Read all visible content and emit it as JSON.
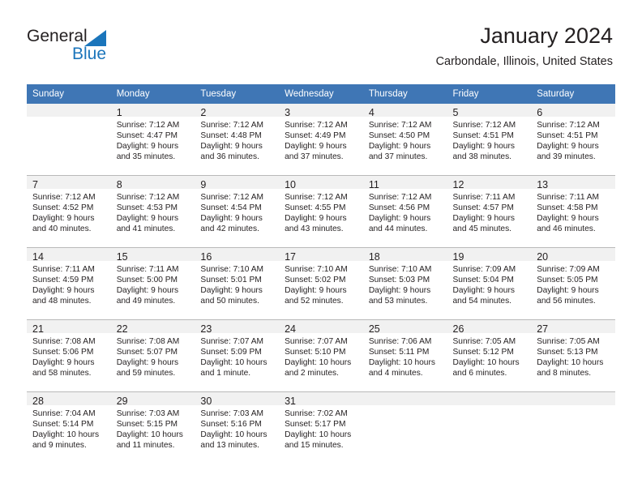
{
  "brand": {
    "name_part1": "General",
    "name_part2": "Blue",
    "logo_icon": "triangle-icon",
    "accent_color": "#1b75bb"
  },
  "header": {
    "title": "January 2024",
    "location": "Carbondale, Illinois, United States",
    "header_bg_color": "#3f76b5"
  },
  "weekdays": [
    "Sunday",
    "Monday",
    "Tuesday",
    "Wednesday",
    "Thursday",
    "Friday",
    "Saturday"
  ],
  "weeks": [
    [
      {
        "day": "",
        "sunrise": "",
        "sunset": "",
        "daylight1": "",
        "daylight2": ""
      },
      {
        "day": "1",
        "sunrise": "Sunrise: 7:12 AM",
        "sunset": "Sunset: 4:47 PM",
        "daylight1": "Daylight: 9 hours",
        "daylight2": "and 35 minutes."
      },
      {
        "day": "2",
        "sunrise": "Sunrise: 7:12 AM",
        "sunset": "Sunset: 4:48 PM",
        "daylight1": "Daylight: 9 hours",
        "daylight2": "and 36 minutes."
      },
      {
        "day": "3",
        "sunrise": "Sunrise: 7:12 AM",
        "sunset": "Sunset: 4:49 PM",
        "daylight1": "Daylight: 9 hours",
        "daylight2": "and 37 minutes."
      },
      {
        "day": "4",
        "sunrise": "Sunrise: 7:12 AM",
        "sunset": "Sunset: 4:50 PM",
        "daylight1": "Daylight: 9 hours",
        "daylight2": "and 37 minutes."
      },
      {
        "day": "5",
        "sunrise": "Sunrise: 7:12 AM",
        "sunset": "Sunset: 4:51 PM",
        "daylight1": "Daylight: 9 hours",
        "daylight2": "and 38 minutes."
      },
      {
        "day": "6",
        "sunrise": "Sunrise: 7:12 AM",
        "sunset": "Sunset: 4:51 PM",
        "daylight1": "Daylight: 9 hours",
        "daylight2": "and 39 minutes."
      }
    ],
    [
      {
        "day": "7",
        "sunrise": "Sunrise: 7:12 AM",
        "sunset": "Sunset: 4:52 PM",
        "daylight1": "Daylight: 9 hours",
        "daylight2": "and 40 minutes."
      },
      {
        "day": "8",
        "sunrise": "Sunrise: 7:12 AM",
        "sunset": "Sunset: 4:53 PM",
        "daylight1": "Daylight: 9 hours",
        "daylight2": "and 41 minutes."
      },
      {
        "day": "9",
        "sunrise": "Sunrise: 7:12 AM",
        "sunset": "Sunset: 4:54 PM",
        "daylight1": "Daylight: 9 hours",
        "daylight2": "and 42 minutes."
      },
      {
        "day": "10",
        "sunrise": "Sunrise: 7:12 AM",
        "sunset": "Sunset: 4:55 PM",
        "daylight1": "Daylight: 9 hours",
        "daylight2": "and 43 minutes."
      },
      {
        "day": "11",
        "sunrise": "Sunrise: 7:12 AM",
        "sunset": "Sunset: 4:56 PM",
        "daylight1": "Daylight: 9 hours",
        "daylight2": "and 44 minutes."
      },
      {
        "day": "12",
        "sunrise": "Sunrise: 7:11 AM",
        "sunset": "Sunset: 4:57 PM",
        "daylight1": "Daylight: 9 hours",
        "daylight2": "and 45 minutes."
      },
      {
        "day": "13",
        "sunrise": "Sunrise: 7:11 AM",
        "sunset": "Sunset: 4:58 PM",
        "daylight1": "Daylight: 9 hours",
        "daylight2": "and 46 minutes."
      }
    ],
    [
      {
        "day": "14",
        "sunrise": "Sunrise: 7:11 AM",
        "sunset": "Sunset: 4:59 PM",
        "daylight1": "Daylight: 9 hours",
        "daylight2": "and 48 minutes."
      },
      {
        "day": "15",
        "sunrise": "Sunrise: 7:11 AM",
        "sunset": "Sunset: 5:00 PM",
        "daylight1": "Daylight: 9 hours",
        "daylight2": "and 49 minutes."
      },
      {
        "day": "16",
        "sunrise": "Sunrise: 7:10 AM",
        "sunset": "Sunset: 5:01 PM",
        "daylight1": "Daylight: 9 hours",
        "daylight2": "and 50 minutes."
      },
      {
        "day": "17",
        "sunrise": "Sunrise: 7:10 AM",
        "sunset": "Sunset: 5:02 PM",
        "daylight1": "Daylight: 9 hours",
        "daylight2": "and 52 minutes."
      },
      {
        "day": "18",
        "sunrise": "Sunrise: 7:10 AM",
        "sunset": "Sunset: 5:03 PM",
        "daylight1": "Daylight: 9 hours",
        "daylight2": "and 53 minutes."
      },
      {
        "day": "19",
        "sunrise": "Sunrise: 7:09 AM",
        "sunset": "Sunset: 5:04 PM",
        "daylight1": "Daylight: 9 hours",
        "daylight2": "and 54 minutes."
      },
      {
        "day": "20",
        "sunrise": "Sunrise: 7:09 AM",
        "sunset": "Sunset: 5:05 PM",
        "daylight1": "Daylight: 9 hours",
        "daylight2": "and 56 minutes."
      }
    ],
    [
      {
        "day": "21",
        "sunrise": "Sunrise: 7:08 AM",
        "sunset": "Sunset: 5:06 PM",
        "daylight1": "Daylight: 9 hours",
        "daylight2": "and 58 minutes."
      },
      {
        "day": "22",
        "sunrise": "Sunrise: 7:08 AM",
        "sunset": "Sunset: 5:07 PM",
        "daylight1": "Daylight: 9 hours",
        "daylight2": "and 59 minutes."
      },
      {
        "day": "23",
        "sunrise": "Sunrise: 7:07 AM",
        "sunset": "Sunset: 5:09 PM",
        "daylight1": "Daylight: 10 hours",
        "daylight2": "and 1 minute."
      },
      {
        "day": "24",
        "sunrise": "Sunrise: 7:07 AM",
        "sunset": "Sunset: 5:10 PM",
        "daylight1": "Daylight: 10 hours",
        "daylight2": "and 2 minutes."
      },
      {
        "day": "25",
        "sunrise": "Sunrise: 7:06 AM",
        "sunset": "Sunset: 5:11 PM",
        "daylight1": "Daylight: 10 hours",
        "daylight2": "and 4 minutes."
      },
      {
        "day": "26",
        "sunrise": "Sunrise: 7:05 AM",
        "sunset": "Sunset: 5:12 PM",
        "daylight1": "Daylight: 10 hours",
        "daylight2": "and 6 minutes."
      },
      {
        "day": "27",
        "sunrise": "Sunrise: 7:05 AM",
        "sunset": "Sunset: 5:13 PM",
        "daylight1": "Daylight: 10 hours",
        "daylight2": "and 8 minutes."
      }
    ],
    [
      {
        "day": "28",
        "sunrise": "Sunrise: 7:04 AM",
        "sunset": "Sunset: 5:14 PM",
        "daylight1": "Daylight: 10 hours",
        "daylight2": "and 9 minutes."
      },
      {
        "day": "29",
        "sunrise": "Sunrise: 7:03 AM",
        "sunset": "Sunset: 5:15 PM",
        "daylight1": "Daylight: 10 hours",
        "daylight2": "and 11 minutes."
      },
      {
        "day": "30",
        "sunrise": "Sunrise: 7:03 AM",
        "sunset": "Sunset: 5:16 PM",
        "daylight1": "Daylight: 10 hours",
        "daylight2": "and 13 minutes."
      },
      {
        "day": "31",
        "sunrise": "Sunrise: 7:02 AM",
        "sunset": "Sunset: 5:17 PM",
        "daylight1": "Daylight: 10 hours",
        "daylight2": "and 15 minutes."
      },
      {
        "day": "",
        "sunrise": "",
        "sunset": "",
        "daylight1": "",
        "daylight2": ""
      },
      {
        "day": "",
        "sunrise": "",
        "sunset": "",
        "daylight1": "",
        "daylight2": ""
      },
      {
        "day": "",
        "sunrise": "",
        "sunset": "",
        "daylight1": "",
        "daylight2": ""
      }
    ]
  ]
}
